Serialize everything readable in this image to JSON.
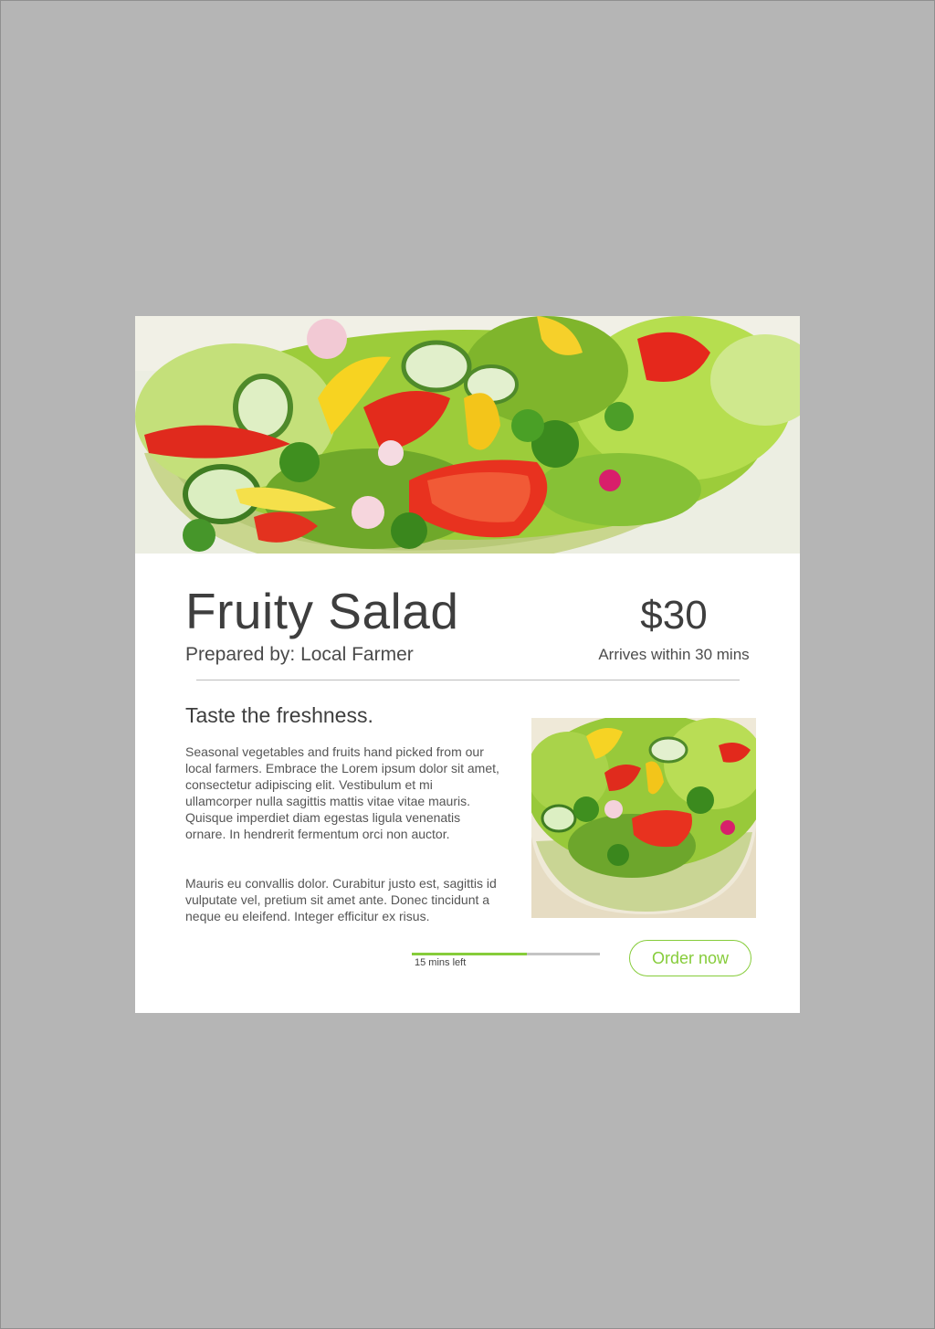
{
  "product": {
    "title": "Fruity Salad",
    "prepared_by": "Prepared by: Local Farmer",
    "price": "$30",
    "arrival": "Arrives within 30 mins"
  },
  "description": {
    "tagline": "Taste the freshness.",
    "paragraphs": [
      "Seasonal vegetables and fruits hand picked from our local farmers. Embrace the Lorem ipsum dolor sit amet, consectetur adipiscing elit. Vestibulum et mi ullamcorper nulla sagittis mattis vitae vitae mauris. Quisque imperdiet diam egestas ligula venenatis ornare. In hendrerit fermentum orci non auctor.",
      "Mauris eu convallis dolor. Curabitur justo est, sagittis id vulputate vel, pretium sit amet ante. Donec tincidunt a neque eu eleifend. Integer efficitur ex risus."
    ]
  },
  "timer": {
    "label": "15 mins left",
    "progress": 0.61
  },
  "actions": {
    "order_label": "Order now"
  },
  "colors": {
    "accent": "#86cc3a",
    "page_background": "#b5b5b5",
    "card": "#ffffff"
  },
  "images": {
    "hero": "salad-bowl-photo",
    "thumbnail": "salad-bowl-photo"
  }
}
